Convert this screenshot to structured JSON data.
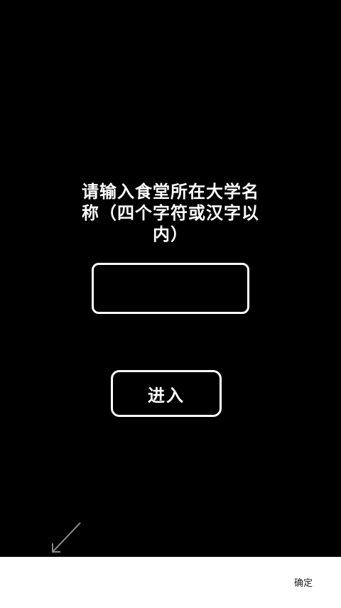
{
  "prompt": {
    "text": "请输入食堂所在大学名称（四个字符或汉字以内）"
  },
  "input": {
    "value": "",
    "placeholder": ""
  },
  "enter_button": {
    "label": "进入"
  },
  "keyboard_toolbar": {
    "confirm_label": "确定"
  },
  "colors": {
    "background": "#000000",
    "foreground": "#ffffff",
    "toolbar_background": "#ffffff"
  }
}
